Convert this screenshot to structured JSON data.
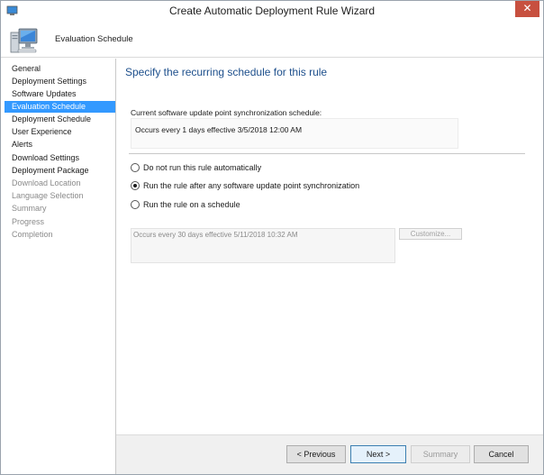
{
  "window": {
    "title": "Create Automatic Deployment Rule Wizard",
    "close_glyph": "✕"
  },
  "header": {
    "title": "Evaluation Schedule",
    "icon": "computer-icon"
  },
  "nav": {
    "items": [
      {
        "label": "General",
        "state": "normal"
      },
      {
        "label": "Deployment Settings",
        "state": "normal"
      },
      {
        "label": "Software Updates",
        "state": "normal"
      },
      {
        "label": "Evaluation Schedule",
        "state": "active"
      },
      {
        "label": "Deployment Schedule",
        "state": "normal"
      },
      {
        "label": "User Experience",
        "state": "normal"
      },
      {
        "label": "Alerts",
        "state": "normal"
      },
      {
        "label": "Download Settings",
        "state": "normal"
      },
      {
        "label": "Deployment Package",
        "state": "normal"
      },
      {
        "label": "Download Location",
        "state": "disabled"
      },
      {
        "label": "Language Selection",
        "state": "disabled"
      },
      {
        "label": "Summary",
        "state": "disabled"
      },
      {
        "label": "Progress",
        "state": "disabled"
      },
      {
        "label": "Completion",
        "state": "disabled"
      }
    ]
  },
  "main": {
    "heading": "Specify the recurring schedule for this rule",
    "current_schedule_label": "Current software update point synchronization schedule:",
    "current_schedule_value": "Occurs every 1 days effective 3/5/2018 12:00 AM",
    "options": [
      {
        "label": "Do not run this rule automatically",
        "checked": false
      },
      {
        "label": "Run the rule after any software update point synchronization",
        "checked": true
      },
      {
        "label": "Run the rule on a schedule",
        "checked": false
      }
    ],
    "schedule_value": "Occurs every 30 days effective 5/11/2018 10:32 AM",
    "customize_label": "Customize..."
  },
  "footer": {
    "previous_label": "< Previous",
    "next_label": "Next >",
    "summary_label": "Summary",
    "cancel_label": "Cancel"
  }
}
